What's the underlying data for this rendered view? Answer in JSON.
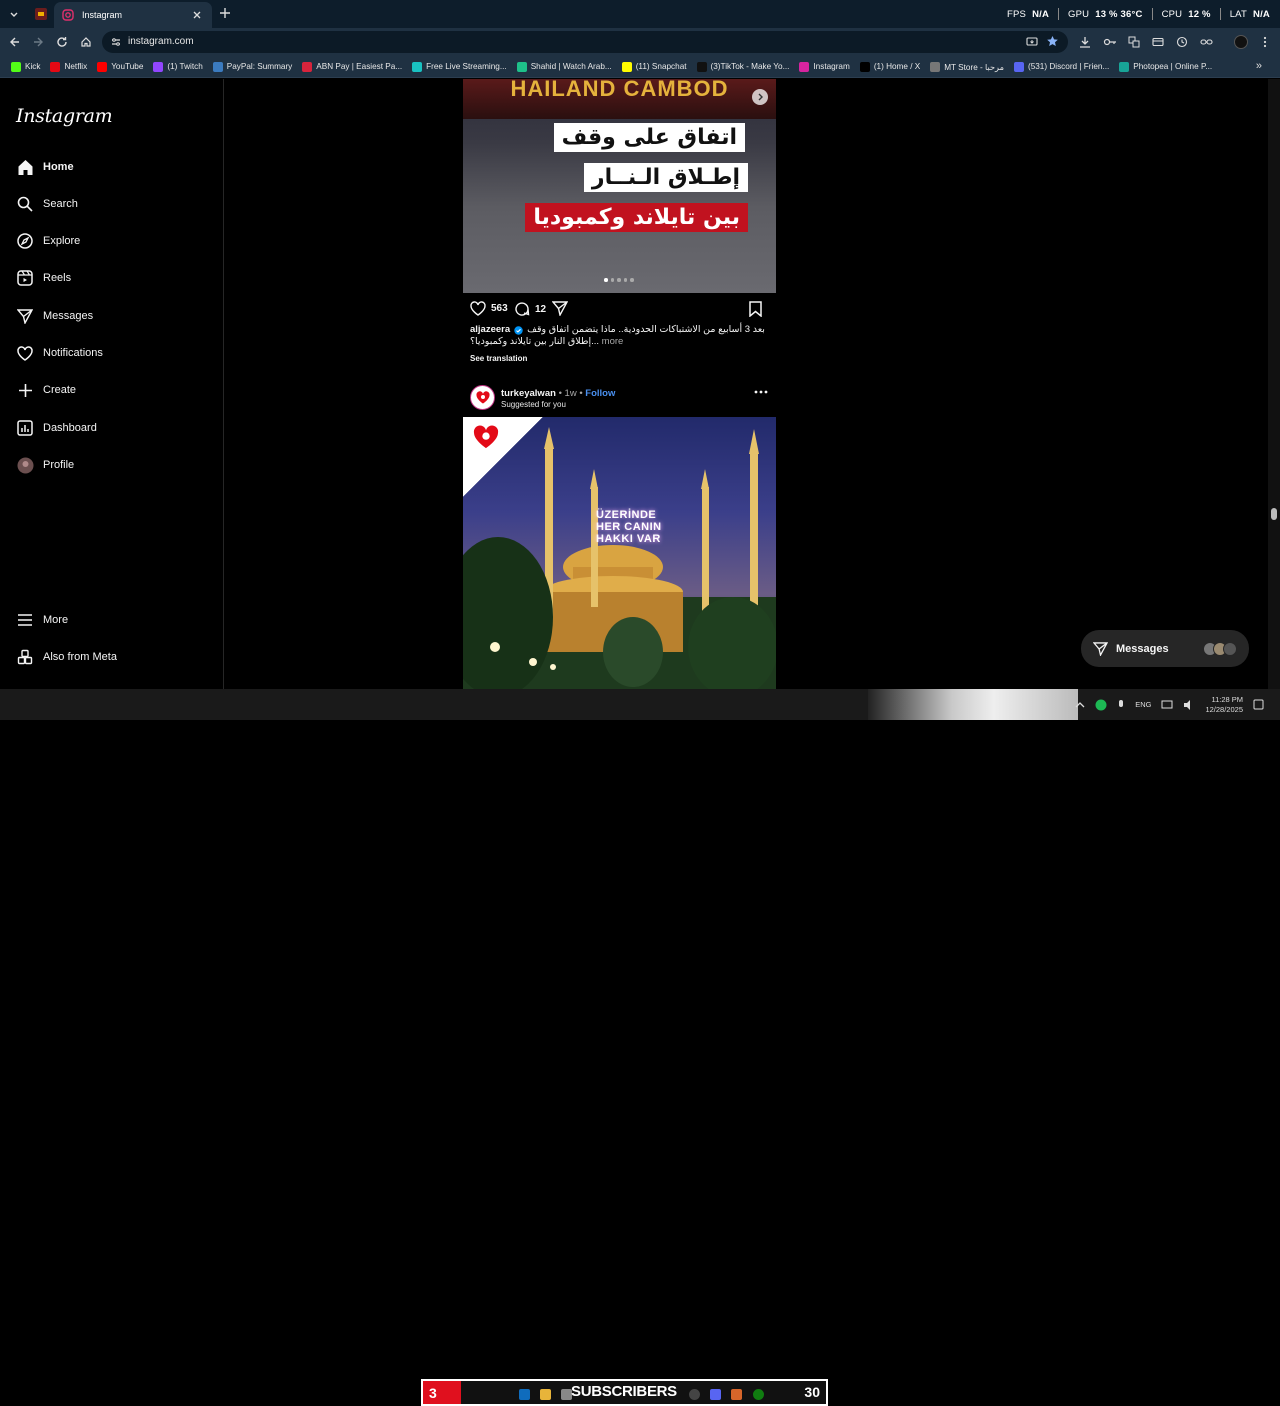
{
  "browser": {
    "tab_title": "Instagram",
    "url": "instagram.com",
    "hud": {
      "fps_label": "FPS",
      "fps_value": "N/A",
      "gpu_label": "GPU",
      "gpu_value": "13 % 36°C",
      "cpu_label": "CPU",
      "cpu_value": "12 %",
      "lat_label": "LAT",
      "lat_value": "N/A"
    },
    "bookmarks": [
      {
        "label": "Kick",
        "color": "#53fc18"
      },
      {
        "label": "Netflix",
        "color": "#e50914"
      },
      {
        "label": "YouTube",
        "color": "#ff0000"
      },
      {
        "label": "(1) Twitch",
        "color": "#9146ff"
      },
      {
        "label": "PayPal: Summary",
        "color": "#3b7bbf"
      },
      {
        "label": "ABN Pay | Easiest Pa...",
        "color": "#d8243c"
      },
      {
        "label": "Free Live Streaming...",
        "color": "#19c2c2"
      },
      {
        "label": "Shahid | Watch Arab...",
        "color": "#1ec08a"
      },
      {
        "label": "(11) Snapchat",
        "color": "#fffc00"
      },
      {
        "label": "(3)TikTok - Make Yo...",
        "color": "#111111"
      },
      {
        "label": "Instagram",
        "color": "#d6249f"
      },
      {
        "label": "(1) Home / X",
        "color": "#000000"
      },
      {
        "label": "MT Store - مرحبا",
        "color": "#777777"
      },
      {
        "label": "(531) Discord | Frien...",
        "color": "#5865f2"
      },
      {
        "label": "Photopea | Online P...",
        "color": "#18a497"
      }
    ]
  },
  "instagram": {
    "logo": "Instagram",
    "nav": [
      {
        "label": "Home",
        "icon": "home-icon"
      },
      {
        "label": "Search",
        "icon": "search-icon"
      },
      {
        "label": "Explore",
        "icon": "explore-icon"
      },
      {
        "label": "Reels",
        "icon": "reels-icon"
      },
      {
        "label": "Messages",
        "icon": "messages-icon"
      },
      {
        "label": "Notifications",
        "icon": "heart-icon"
      },
      {
        "label": "Create",
        "icon": "plus-icon"
      },
      {
        "label": "Dashboard",
        "icon": "dashboard-icon"
      },
      {
        "label": "Profile",
        "icon": "avatar"
      }
    ],
    "more": "More",
    "also_from_meta": "Also from Meta",
    "post1": {
      "banner_text": "HAILAND CAMBOD",
      "overlay_line1": "اتفاق على وقف",
      "overlay_line2": "إطـلاق الـنــار",
      "overlay_line3": "بين تايلاند وكمبوديا",
      "likes": "563",
      "comments": "12",
      "username": "aljazeera",
      "caption_line1": "بعد 3 أسابيع من الاشتباكات الحدودية.. ماذا يتضمن اتفاق وقف",
      "caption_line2": "إطلاق النار بين تايلاند وكمبوديا؟...",
      "more": "more",
      "see_translation": "See translation"
    },
    "post2": {
      "username": "turkeyalwan",
      "time": "1w",
      "follow": "Follow",
      "suggested": "Suggested for you",
      "sign_line1": "ÜZERİNDE",
      "sign_line2": "HER CANIN",
      "sign_line3": "HAKKI VAR"
    },
    "messages_pill": "Messages"
  },
  "taskbar": {
    "overlay_left": "3",
    "overlay_label": "SUBSCRIBERS",
    "overlay_right": "30",
    "lang": "ENG",
    "time": "11:28 PM",
    "date": "12/28/2025"
  }
}
